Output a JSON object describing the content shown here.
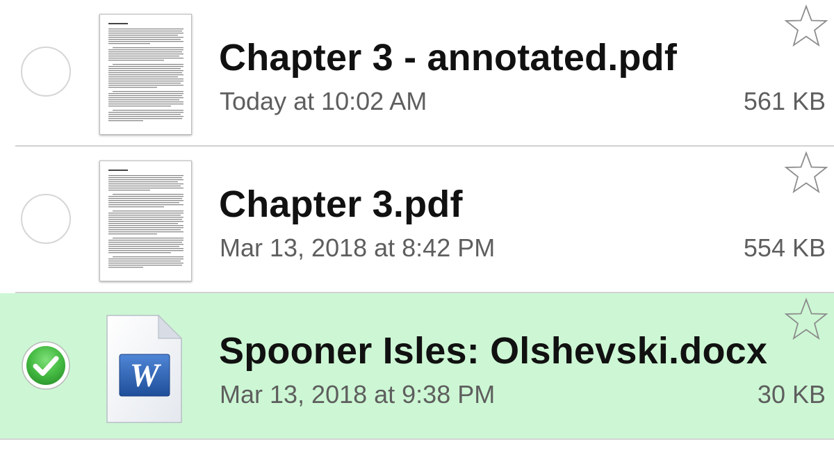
{
  "files": [
    {
      "name": "Chapter 3 - annotated.pdf",
      "date": "Today at 10:02 AM",
      "size": "561 KB",
      "type": "pdf",
      "selected": false,
      "favorite": false
    },
    {
      "name": "Chapter 3.pdf",
      "date": "Mar 13, 2018 at 8:42 PM",
      "size": "554 KB",
      "type": "pdf",
      "selected": false,
      "favorite": false
    },
    {
      "name": "Spooner Isles: Olshevski.docx",
      "date": "Mar 13, 2018 at 9:38 PM",
      "size": "30 KB",
      "type": "docx",
      "selected": true,
      "favorite": false
    }
  ],
  "colors": {
    "selected_row": "#cdf7d4",
    "check_green": "#4cc04a",
    "text_primary": "#111111",
    "text_secondary": "#5e5e5e",
    "divider": "#d2d2d2",
    "word_blue": "#2b5fb3"
  },
  "icons": {
    "select": "selection-circle-icon",
    "selected": "checkmark-circle-icon",
    "favorite": "star-outline-icon",
    "pdf": "pdf-page-thumbnail",
    "docx": "word-document-icon"
  }
}
